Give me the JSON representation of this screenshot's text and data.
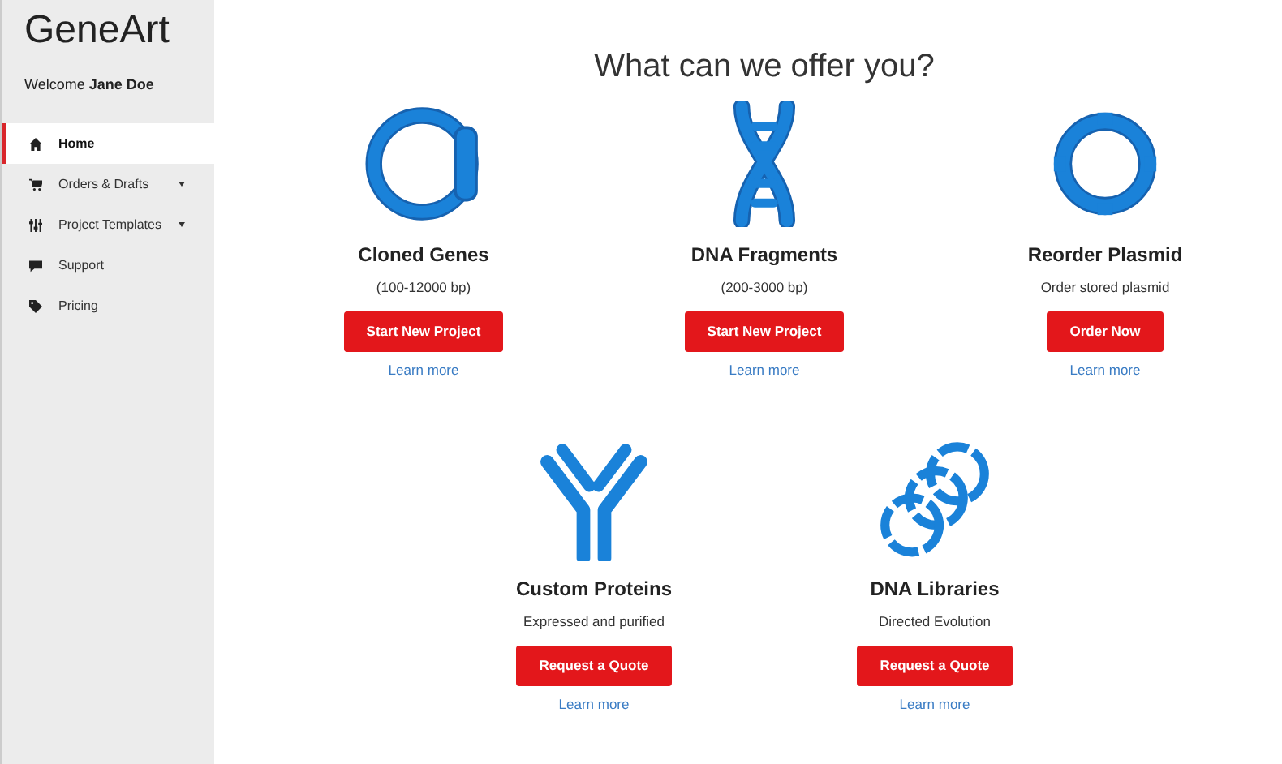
{
  "sidebar": {
    "logo": "GeneArt",
    "welcome": "Welcome **Jane Doe**",
    "items": [
      {
        "label": "Home",
        "kind": "home",
        "selected": true,
        "has_submenu": false
      },
      {
        "label": "Orders & Drafts",
        "kind": "cart",
        "selected": false,
        "has_submenu": true
      },
      {
        "label": "Project Templates",
        "kind": "sliders",
        "selected": false,
        "has_submenu": true
      },
      {
        "label": "Support",
        "kind": "chat",
        "selected": false,
        "has_submenu": false
      },
      {
        "label": "Pricing",
        "kind": "tag",
        "selected": false,
        "has_submenu": false
      }
    ]
  },
  "heading": "What can we offer you?",
  "offers": [
    [
      {
        "kind": "ring",
        "title": "Cloned Genes",
        "subtitle": "(100-12000 bp)",
        "button": "Start New Project",
        "link": "Learn more"
      },
      {
        "kind": "helix",
        "title": "DNA Fragments",
        "subtitle": "(200-3000 bp)",
        "button": "Start New Project",
        "link": "Learn more"
      },
      {
        "kind": "plasmid",
        "title": "Reorder Plasmid",
        "subtitle": "Order stored plasmid",
        "button": "Order Now",
        "link": "Learn more"
      }
    ],
    [
      {
        "kind": "antibody",
        "title": "Custom Proteins",
        "subtitle": "Expressed and purified",
        "button": "Request a Quote",
        "link": "Learn more"
      },
      {
        "kind": "rings",
        "title": "DNA Libraries",
        "subtitle": "Directed Evolution",
        "button": "Request a Quote",
        "link": "Learn more"
      }
    ]
  ]
}
